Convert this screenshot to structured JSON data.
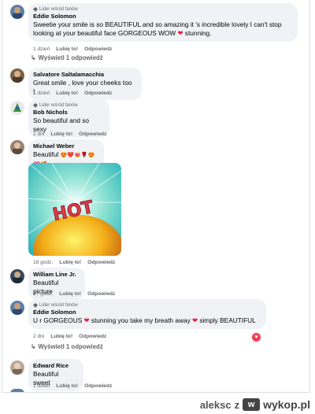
{
  "comments": [
    {
      "badge": "Lider wśród fanów",
      "author": "Eddie Solomon",
      "text_line1": "Sweetie your smile is so BEAUTIFUL and so amazing it 's incredible lovely I can't stop",
      "text_line2": "looking at your beautiful face GORGEOUS WOW",
      "text_line2_end": "stunning.",
      "time": "1 dzień",
      "like": "Lubię to!",
      "reply": "Odpowiedz",
      "replies_label": "Wyświetl 1 odpowiedź"
    },
    {
      "author": "Salvatore Saltalamacchia",
      "text": "Great smile , love your cheeks too !",
      "time": "1 dzień",
      "like": "Lubię to!",
      "reply": "Odpowiedz"
    },
    {
      "badge": "Lider wśród fanów",
      "author": "Bob Nichols",
      "text": "So beautiful and so sexy",
      "time": "2 dni",
      "like": "Lubię to!",
      "reply": "Odpowiedz"
    },
    {
      "author": "Michael Weber",
      "text": "Beautiful",
      "emojis": "😍❤️😻🌹😍💝🥰",
      "image_text": "HOT",
      "time": "18 godz.",
      "like": "Lubię to!",
      "reply": "Odpowiedz"
    },
    {
      "author": "William Line Jr.",
      "text": "Beautiful picture",
      "time": "17 godz.",
      "like": "Lubię to!",
      "reply": "Odpowiedz"
    },
    {
      "badge": "Lider wśród fanów",
      "author": "Eddie Solomon",
      "text_a": "U r GORGEOUS",
      "text_b": "stunning you take my breath away",
      "text_c": "simply BEAUTIFUL",
      "time": "2 dni",
      "like": "Lubię to!",
      "reply": "Odpowiedz",
      "replies_label": "Wyświetl 1 odpowiedź"
    },
    {
      "author": "Edward Rice",
      "text": "Beautiful sweet",
      "time": "1 dzień",
      "like": "Lubię to!",
      "reply": "Odpowiedz"
    }
  ],
  "footer": {
    "user": "aleksc",
    "separator": "z",
    "logo_letter": "w",
    "site": "wykop.pl"
  },
  "colors": {
    "bubble": "#f0f2f5",
    "heart": "#e41e3f",
    "meta": "#65676b"
  }
}
